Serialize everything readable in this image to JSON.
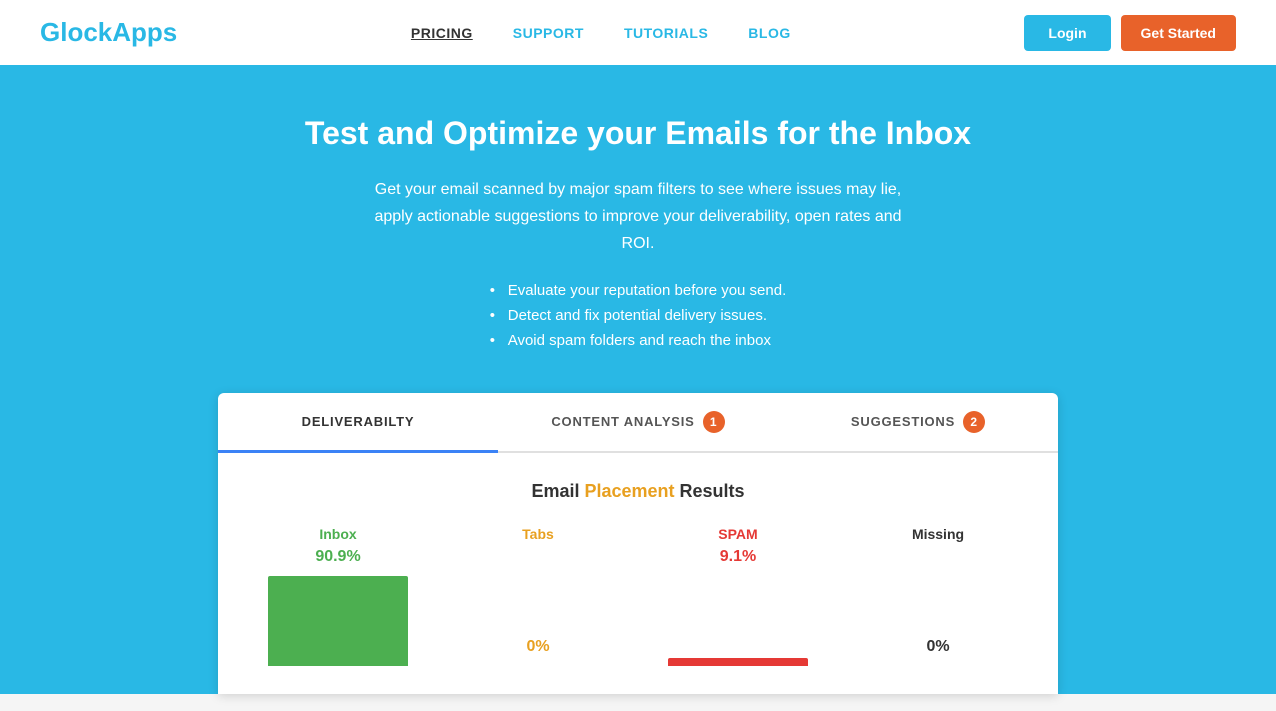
{
  "header": {
    "logo_black": "Glock",
    "logo_cyan": "Apps",
    "nav": [
      {
        "label": "PRICING",
        "active": true,
        "id": "pricing"
      },
      {
        "label": "SUPPORT",
        "active": false,
        "id": "support"
      },
      {
        "label": "TUTORIALS",
        "active": false,
        "id": "tutorials"
      },
      {
        "label": "BLOG",
        "active": false,
        "id": "blog"
      }
    ],
    "login_label": "Login",
    "get_started_label": "Get Started"
  },
  "hero": {
    "title": "Test and Optimize your Emails for the Inbox",
    "description": "Get your email scanned by major spam filters to see where issues may lie, apply actionable suggestions to improve your deliverability, open rates and ROI.",
    "bullets": [
      "Evaluate your reputation before you send.",
      "Detect and fix potential delivery issues.",
      "Avoid spam folders and reach the inbox"
    ]
  },
  "card": {
    "tabs": [
      {
        "label": "DELIVERABILTY",
        "active": true,
        "badge": null,
        "id": "deliverability"
      },
      {
        "label": "CONTENT ANALYSIS",
        "active": false,
        "badge": "1",
        "id": "content-analysis"
      },
      {
        "label": "SUGGESTIONS",
        "active": false,
        "badge": "2",
        "id": "suggestions"
      }
    ],
    "results": {
      "title_black": "Email ",
      "title_orange": "Placement",
      "title_suffix": " Results",
      "columns": [
        {
          "label": "Inbox",
          "label_class": "label-inbox",
          "pct": "90.9%",
          "pct_class": "pct-inbox",
          "bar_type": "inbox"
        },
        {
          "label": "Tabs",
          "label_class": "label-tabs",
          "pct": "0%",
          "pct_class": "pct-tabs",
          "bar_type": "zero"
        },
        {
          "label": "SPAM",
          "label_class": "label-spam",
          "pct": "9.1%",
          "pct_class": "pct-spam",
          "bar_type": "spam"
        },
        {
          "label": "Missing",
          "label_class": "label-missing",
          "pct": "0%",
          "pct_class": "pct-missing",
          "bar_type": "zero"
        }
      ]
    }
  }
}
